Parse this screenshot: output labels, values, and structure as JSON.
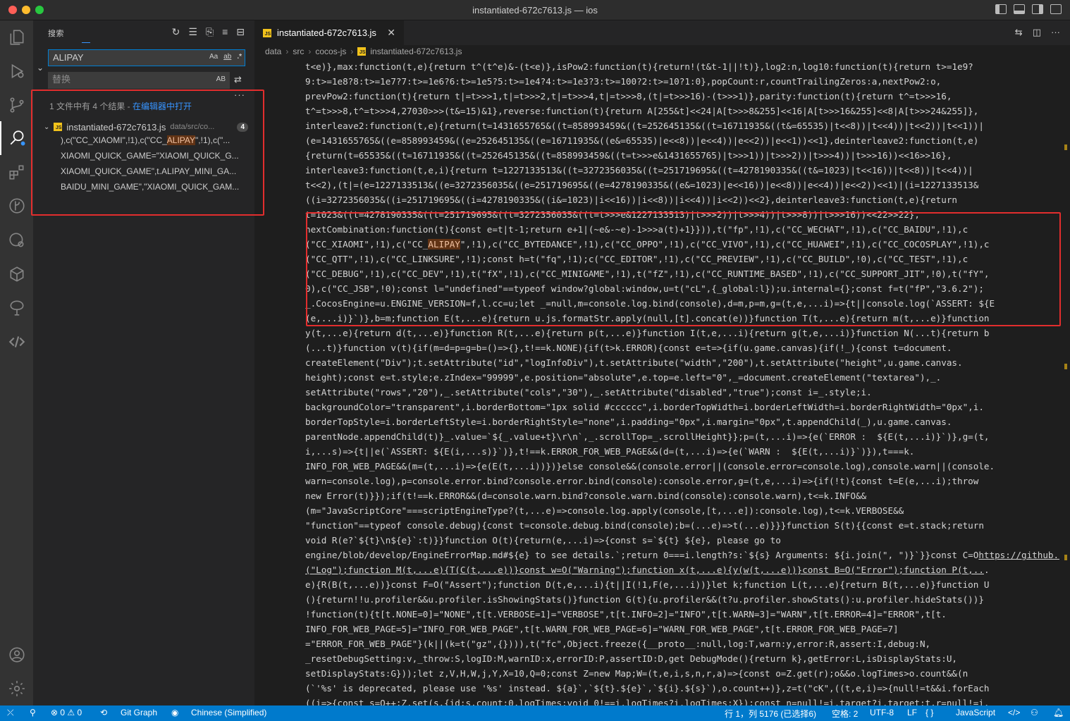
{
  "window": {
    "title": "instantiated-672c7613.js — ios"
  },
  "sidebar": {
    "title": "搜索",
    "search_value": "ALIPAY",
    "search_opts": [
      "Aa",
      "ab",
      ".*"
    ],
    "replace_placeholder": "替换",
    "replace_opt": "AB",
    "summary_prefix": "1 文件中有 4 个结果 - ",
    "summary_link": "在编辑器中打开",
    "file": {
      "name": "instantiated-672c7613.js",
      "path": "data/src/co...",
      "count": "4"
    },
    "matches": [
      {
        "pre": "),c(\"CC_XIAOMI\",!1),c(\"CC_",
        "hit": "ALIPAY",
        "post": "\",!1),c(\"..."
      },
      {
        "pre": "XIAOMI_QUICK_GAME=\"XIAOMI_QUICK_G...",
        "hit": "",
        "post": ""
      },
      {
        "pre": "XIAOMI_QUICK_GAME\",t.ALIPAY_MINI_GA...",
        "hit": "",
        "post": ""
      },
      {
        "pre": "BAIDU_MINI_GAME\",\"XIAOMI_QUICK_GAM...",
        "hit": "",
        "post": ""
      }
    ]
  },
  "editor": {
    "tab_label": "instantiated-672c7613.js",
    "breadcrumb": [
      "data",
      "src",
      "cocos-js",
      "instantiated-672c7613.js"
    ],
    "lines": [
      "t<e)},max:function(t,e){return t^(t^e)&-(t<e)},isPow2:function(t){return!(t&t-1||!t)},log2:n,log10:function(t){return t>=1e9?",
      "9:t>=1e8?8:t>=1e7?7:t>=1e6?6:t>=1e5?5:t>=1e4?4:t>=1e3?3:t>=100?2:t>=10?1:0},popCount:r,countTrailingZeros:a,nextPow2:o,",
      "prevPow2:function(t){return t|=t>>>1,t|=t>>>2,t|=t>>>4,t|=t>>>8,(t|=t>>>16)-(t>>>1)},parity:function(t){return t^=t>>>16,",
      "t^=t>>>8,t^=t>>>4,27030>>>(t&=15)&1},reverse:function(t){return A[255&t]<<24|A[t>>>8&255]<<16|A[t>>>16&255]<<8|A[t>>>24&255]},",
      "interleave2:function(t,e){return(t=1431655765&((t=858993459&((t=252645135&((t=16711935&((t&=65535)|t<<8))|t<<4))|t<<2))|t<<1))|",
      "(e=1431655765&((e=858993459&((e=252645135&((e=16711935&((e&=65535)|e<<8))|e<<4))|e<<2))|e<<1))<<1},deinterleave2:function(t,e)",
      "{return(t=65535&((t=16711935&((t=252645135&((t=858993459&((t=t>>>e&1431655765)|t>>>1))|t>>>2))|t>>>4))|t>>>16))<<16>>16},",
      "interleave3:function(t,e,i){return t=1227133513&((t=3272356035&((t=251719695&((t=4278190335&((t&=1023)|t<<16))|t<<8))|t<<4))|",
      "t<<2),(t|=(e=1227133513&((e=3272356035&((e=251719695&((e=4278190335&((e&=1023)|e<<16))|e<<8))|e<<4))|e<<2))<<1)|(i=1227133513&",
      "((i=3272356035&((i=251719695&((i=4278190335&((i&=1023)|i<<16))|i<<8))|i<<4))|i<<2))<<2},deinterleave3:function(t,e){return",
      "t=1023&((t=4278190335&((t=251719695&((t=3272356035&((t=t>>>e&1227133513)|t>>>2))|t>>>4))|t>>>8))|t>>>16))<<22>>22},",
      "nextCombination:function(t){const e=t|t-1;return e+1|(~e&-~e)-1>>>a(t)+1}})),t(\"fp\",!1),c(\"CC_WECHAT\",!1),c(\"CC_BAIDU\",!1),c",
      "(\"CC_XIAOMI\",!1),c(\"CC_ALIPAY\",!1),c(\"CC_BYTEDANCE\",!1),c(\"CC_OPPO\",!1),c(\"CC_VIVO\",!1),c(\"CC_HUAWEI\",!1),c(\"CC_COCOSPLAY\",!1),c",
      "(\"CC_QTT\",!1),c(\"CC_LINKSURE\",!1);const h=t(\"fq\",!1);c(\"CC_EDITOR\",!1),c(\"CC_PREVIEW\",!1),c(\"CC_BUILD\",!0),c(\"CC_TEST\",!1),c",
      "(\"CC_DEBUG\",!1),c(\"CC_DEV\",!1),t(\"fX\",!1),c(\"CC_MINIGAME\",!1),t(\"fZ\",!1),c(\"CC_RUNTIME_BASED\",!1),c(\"CC_SUPPORT_JIT\",!0),t(\"fY\",",
      "0),c(\"CC_JSB\",!0);const l=\"undefined\"==typeof window?global:window,u=t(\"cL\",{_global:l});u.internal={};const f=t(\"fP\",\"3.6.2\");",
      "_.CocosEngine=u.ENGINE_VERSION=f,l.cc=u;let _=null,m=console.log.bind(console),d=m,p=m,g=(t,e,...i)=>{t||console.log(`ASSERT: ${E",
      "(e,...i)}`)},b=m;function E(t,...e){return u.js.formatStr.apply(null,[t].concat(e))}function T(t,...e){return m(t,...e)}function",
      "y(t,...e){return d(t,...e)}function R(t,...e){return p(t,...e)}function I(t,e,...i){return g(t,e,...i)}function N(...t){return b",
      "(...t)}function v(t){if(m=d=p=g=b=()=>{},t!==k.NONE){if(t>k.ERROR){const e=t=>{if(u.game.canvas){if(!_){const t=document.",
      "createElement(\"Div\");t.setAttribute(\"id\",\"logInfoDiv\"),t.setAttribute(\"width\",\"200\"),t.setAttribute(\"height\",u.game.canvas.",
      "height);const e=t.style;e.zIndex=\"99999\",e.position=\"absolute\",e.top=e.left=\"0\",_=document.createElement(\"textarea\"),_.",
      "setAttribute(\"rows\",\"20\"),_.setAttribute(\"cols\",\"30\"),_.setAttribute(\"disabled\",\"true\");const i=_.style;i.",
      "backgroundColor=\"transparent\",i.borderBottom=\"1px solid #cccccc\",i.borderTopWidth=i.borderLeftWidth=i.borderRightWidth=\"0px\",i.",
      "borderTopStyle=i.borderLeftStyle=i.borderRightStyle=\"none\",i.padding=\"0px\",i.margin=\"0px\",t.appendChild(_),u.game.canvas.",
      "parentNode.appendChild(t)}_.value=`${_.value+t}\\r\\n`,_.scrollTop=_.scrollHeight}};p=(t,...i)=>{e(`ERROR :  ${E(t,...i)}`)},g=(t,",
      "i,...s)=>{t||e(`ASSERT: ${E(i,...s)}`)},t!==k.ERROR_FOR_WEB_PAGE&&(d=(t,...i)=>{e(`WARN :  ${E(t,...i)}`)}),t===k.",
      "INFO_FOR_WEB_PAGE&&(m=(t,...i)=>{e(E(t,...i))})}else console&&(console.error||(console.error=console.log),console.warn||(console.",
      "warn=console.log),p=console.error.bind?console.error.bind(console):console.error,g=(t,e,...i)=>{if(!t){const t=E(e,...i);throw",
      "new Error(t)}});if(t!==k.ERROR&&(d=console.warn.bind?console.warn.bind(console):console.warn),t<=k.INFO&&",
      "(m=\"JavaScriptCore\"===scriptEngineType?(t,...e)=>console.log.apply(console,[t,...e]):console.log),t<=k.VERBOSE&&",
      "\"function\"==typeof console.debug){const t=console.debug.bind(console);b=(...e)=>t(...e)}}}function S(t){{const e=t.stack;return",
      "void R(e?`${t}\\n${e}`:t)}}function O(t){return(e,...i)=>{const s=`${t} ${e}, please go to ",
      "engine/blob/develop/EngineErrorMap.md#${e} to see details.`;return 0===i.length?s:`${s} Arguments: ${i.join(\", \")}`}}const C=O",
      "(\"Log\");function M(t,...e){T(C(t,...e))}const w=O(\"Warning\");function x(t,...e){y(w(t,...e))}const B=O(\"Error\");function P(t,...",
      "e){R(B(t,...e))}const F=O(\"Assert\");function D(t,e,...i){t||I(!1,F(e,...i))}let k;function L(t,...e){return B(t,...e)}function U",
      "(){return!!u.profiler&&u.profiler.isShowingStats()}function G(t){u.profiler&&(t?u.profiler.showStats():u.profiler.hideStats())}",
      "!function(t){t[t.NONE=0]=\"NONE\",t[t.VERBOSE=1]=\"VERBOSE\",t[t.INFO=2]=\"INFO\",t[t.WARN=3]=\"WARN\",t[t.ERROR=4]=\"ERROR\",t[t.",
      "INFO_FOR_WEB_PAGE=5]=\"INFO_FOR_WEB_PAGE\",t[t.WARN_FOR_WEB_PAGE=6]=\"WARN_FOR_WEB_PAGE\",t[t.ERROR_FOR_WEB_PAGE=7]",
      "=\"ERROR_FOR_WEB_PAGE\"}(k||(k=t(\"gz\",{}))),t(\"fc\",Object.freeze({__proto__:null,log:T,warn:y,error:R,assert:I,debug:N,",
      "_resetDebugSetting:v,_throw:S,logID:M,warnID:x,errorID:P,assertID:D,get DebugMode(){return k},getError:L,isDisplayStats:U,",
      "setDisplayStats:G}));let z,V,H,W,j,Y,X=10,Q=0;const Z=new Map;W=(t,e,i,s,n,r,a)=>{const o=Z.get(r);o&&o.logTimes>o.count&&(n",
      "(`'%s' is deprecated, please use '%s' instead. ${a}`,`${t}.${e}`,`${i}.${s}`),o.count++)},z=t(\"cK\",((t,e,i)=>{null!=t&&i.forEach",
      "((i=>{const s=Q++;Z.set(s,{id:s,count:0,logTimes:void 0!==i.logTimes?i.logTimes:X});const n=null!=i.target?i.target:t,r=null!=i."
    ],
    "link_text": "https://github.com/cocos-creator/",
    "match_text": "ALIPAY"
  },
  "status": {
    "problems": "0",
    "warnings": "0",
    "git": "Git Graph",
    "locale": "Chinese (Simplified)",
    "position": "行 1，列 5176 (已选择6)",
    "indent": "空格: 2",
    "encoding": "UTF-8",
    "eol": "LF",
    "language": "JavaScript"
  }
}
